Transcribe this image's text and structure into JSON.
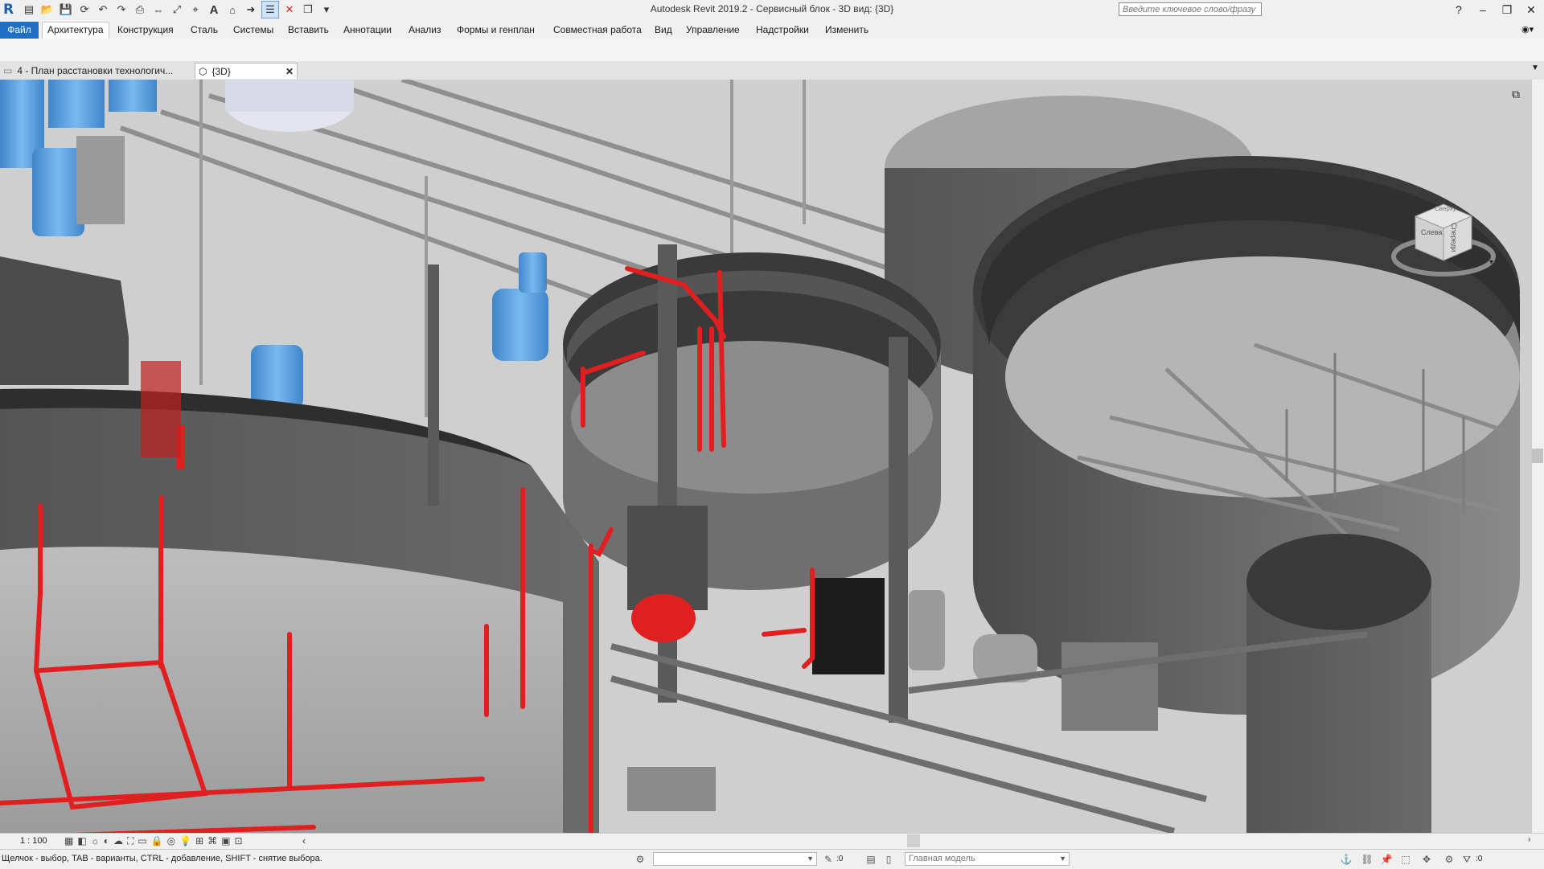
{
  "window": {
    "title": "Autodesk Revit 2019.2 - Сервисный блок - 3D вид: {3D}",
    "search_placeholder": "Введите ключевое слово/фразу"
  },
  "quick_access": [
    "open-icon",
    "save-icon",
    "sync-icon",
    "undo-icon",
    "redo-icon",
    "print-icon",
    "measure-icon",
    "dimension-icon",
    "tag-icon",
    "text-icon",
    "3d-view-icon",
    "section-icon",
    "thin-lines-icon",
    "close-hidden-icon",
    "switch-windows-icon",
    "customize-icon"
  ],
  "ribbon": {
    "tabs": [
      "Файл",
      "Архитектура",
      "Конструкция",
      "Сталь",
      "Системы",
      "Вставить",
      "Аннотации",
      "Анализ",
      "Формы и генплан",
      "Совместная работа",
      "Вид",
      "Управление",
      "Надстройки",
      "Изменить"
    ],
    "active_tab": "Архитектура"
  },
  "doc_tabs": [
    {
      "label": "4 - План расстановки технологич...",
      "active": false
    },
    {
      "label": "{3D}",
      "active": true
    }
  ],
  "viewcube": {
    "left_face": "Слева",
    "right_face": "Спереди",
    "top_face": "Сверху"
  },
  "viewbar": {
    "scale": "1 : 100"
  },
  "status": {
    "hint": "Щелчок - выбор, TAB - варианты, CTRL - добавление, SHIFT - снятие выбора.",
    "workset_count": ":0",
    "model_combo": "Главная модель",
    "filter_count": ":0"
  },
  "colors": {
    "accent": "#1f6fc7",
    "pipe_red": "#e02020",
    "tank_blue": "#5aa6e6"
  }
}
